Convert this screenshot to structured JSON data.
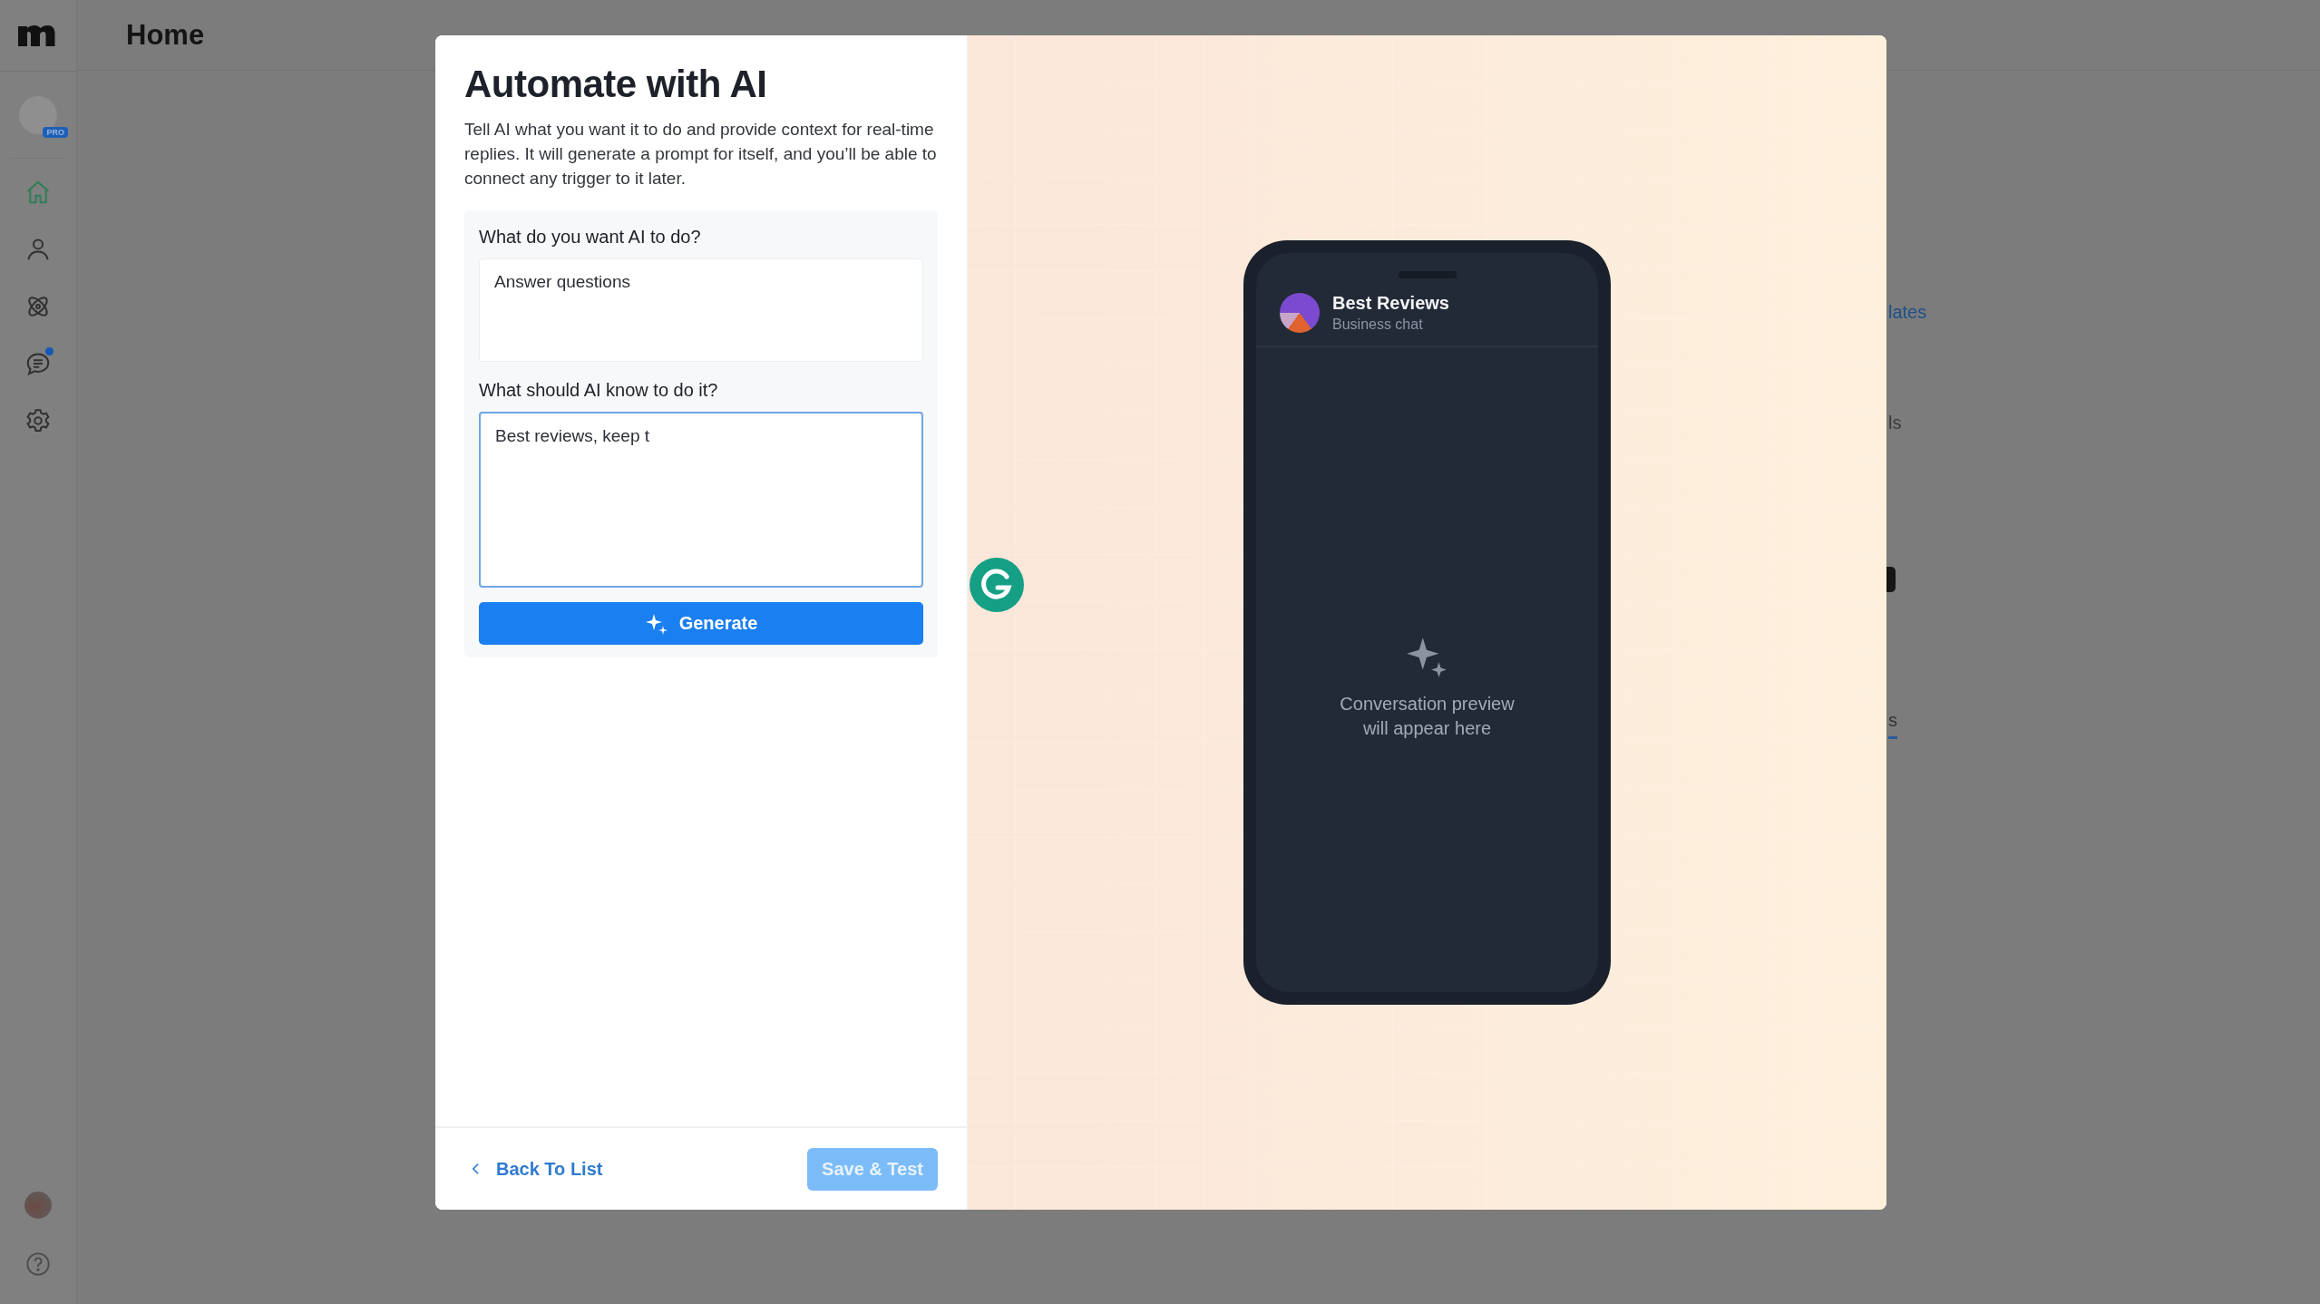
{
  "topbar": {
    "title": "Home"
  },
  "sidebar": {
    "profile": {
      "badge": "PRO"
    },
    "nav": [
      {
        "kind": "home",
        "selected": true,
        "notification": false
      },
      {
        "kind": "person",
        "selected": false,
        "notification": false
      },
      {
        "kind": "atom",
        "selected": false,
        "notification": false
      },
      {
        "kind": "chat",
        "selected": false,
        "notification": true
      },
      {
        "kind": "gear",
        "selected": false,
        "notification": false
      }
    ]
  },
  "background_fragments": [
    {
      "kind": "link",
      "text": "lates"
    },
    {
      "kind": "text",
      "text": "ls"
    },
    {
      "kind": "tag"
    },
    {
      "kind": "tab",
      "text": "s"
    }
  ],
  "modal": {
    "title": "Automate with AI",
    "description": "Tell AI what you want it to do and provide context for real-time replies. It will generate a prompt for itself, and you’ll be able to connect any trigger to it later.",
    "fields": [
      {
        "label": "What do you want AI to do?",
        "value": "Answer questions",
        "focused": false
      },
      {
        "label": "What should AI know to do it?",
        "value": "Best reviews, keep t",
        "focused": true
      }
    ],
    "generate_button": "Generate",
    "back_link": "Back To List",
    "save_button": {
      "label": "Save & Test",
      "disabled": true
    },
    "preview": {
      "contact_name": "Best Reviews",
      "contact_subtitle": "Business chat",
      "empty_text": "Conversation preview will appear here"
    }
  }
}
